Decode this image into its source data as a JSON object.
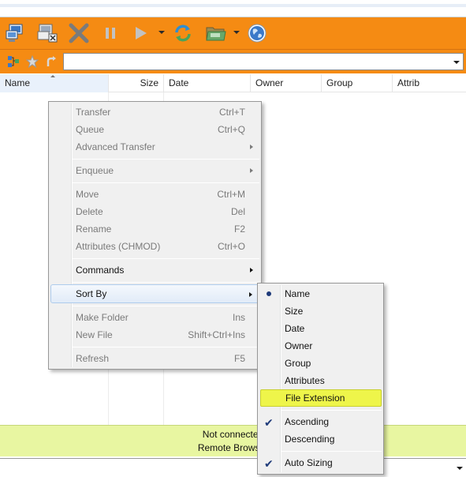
{
  "toolbar": {
    "buttons": [
      {
        "name": "connect-icon"
      },
      {
        "name": "disconnect-icon"
      },
      {
        "name": "abort-icon"
      },
      {
        "name": "pause-icon"
      },
      {
        "name": "play-icon"
      },
      {
        "name": "refresh-icon"
      },
      {
        "name": "folder-icon"
      },
      {
        "name": "globe-icon"
      }
    ],
    "accent_color": "#f58b13"
  },
  "address_bar": {
    "icons": [
      "sitemap-icon",
      "favorites-star-icon",
      "go-up-icon"
    ],
    "value": ""
  },
  "columns": [
    "Name",
    "Size",
    "Date",
    "Owner",
    "Group",
    "Attrib"
  ],
  "status": {
    "line1": "Not connected",
    "line2": "Remote Browser",
    "background": "#e8f6a1"
  },
  "context_menu": {
    "items": [
      {
        "label": "Transfer",
        "shortcut": "Ctrl+T",
        "enabled": false
      },
      {
        "label": "Queue",
        "shortcut": "Ctrl+Q",
        "enabled": false
      },
      {
        "label": "Advanced Transfer",
        "submenu": true,
        "enabled": false
      },
      {
        "label": "Enqueue",
        "submenu": true,
        "enabled": false
      },
      {
        "label": "Move",
        "shortcut": "Ctrl+M",
        "enabled": false
      },
      {
        "label": "Delete",
        "shortcut": "Del",
        "enabled": false
      },
      {
        "label": "Rename",
        "shortcut": "F2",
        "enabled": false
      },
      {
        "label": "Attributes (CHMOD)",
        "shortcut": "Ctrl+O",
        "enabled": false
      },
      {
        "label": "Commands",
        "submenu": true,
        "enabled": true
      },
      {
        "label": "Sort By",
        "submenu": true,
        "enabled": true,
        "highlighted": true
      },
      {
        "label": "Make Folder",
        "shortcut": "Ins",
        "enabled": false
      },
      {
        "label": "New File",
        "shortcut": "Shift+Ctrl+Ins",
        "enabled": false
      },
      {
        "label": "Refresh",
        "shortcut": "F5",
        "enabled": false
      }
    ]
  },
  "sort_submenu": {
    "items": [
      {
        "label": "Name",
        "mark": "radio"
      },
      {
        "label": "Size"
      },
      {
        "label": "Date"
      },
      {
        "label": "Owner"
      },
      {
        "label": "Group"
      },
      {
        "label": "Attributes"
      },
      {
        "label": "File Extension",
        "highlighted": true
      },
      {
        "label": "Ascending",
        "mark": "check"
      },
      {
        "label": "Descending"
      },
      {
        "label": "Auto Sizing",
        "mark": "check"
      }
    ],
    "highlight_color": "#eef54a"
  }
}
